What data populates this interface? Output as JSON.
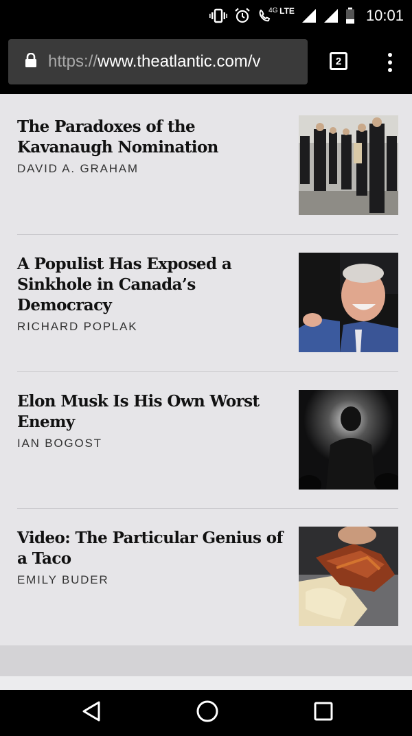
{
  "status_bar": {
    "time": "10:01",
    "network": "LTE",
    "network_sub": "4G",
    "icons": [
      "vibrate-icon",
      "alarm-icon",
      "wifi-call-icon",
      "signal-icon",
      "signal-icon",
      "battery-icon"
    ]
  },
  "browser": {
    "url_scheme": "https://",
    "url_rest": "www.theatlantic.com/v",
    "tab_count": "2",
    "icons": [
      "lock-icon",
      "tabs-icon",
      "more-vert-icon"
    ]
  },
  "articles": [
    {
      "title": "The Paradoxes of the Kavanaugh Nomination",
      "author": "DAVID A. GRAHAM",
      "thumbnail": "crowd-walking-photo"
    },
    {
      "title": "A Populist Has Exposed a Sinkhole in Canada’s Democracy",
      "author": "RICHARD POPLAK",
      "thumbnail": "smiling-politician-photo"
    },
    {
      "title": "Elon Musk Is His Own Worst Enemy",
      "author": "IAN BOGOST",
      "thumbnail": "silhouette-on-stage-photo"
    },
    {
      "title": "Video: The Particular Genius of a Taco",
      "author": "EMILY BUDER",
      "thumbnail": "taco-photo"
    }
  ],
  "nav_bar": {
    "icons": [
      "back-icon",
      "home-icon",
      "recents-icon"
    ]
  },
  "colors": {
    "page_background": "#e6e5e8",
    "url_box": "#3a3a3a",
    "divider": "#c9c8cc"
  }
}
